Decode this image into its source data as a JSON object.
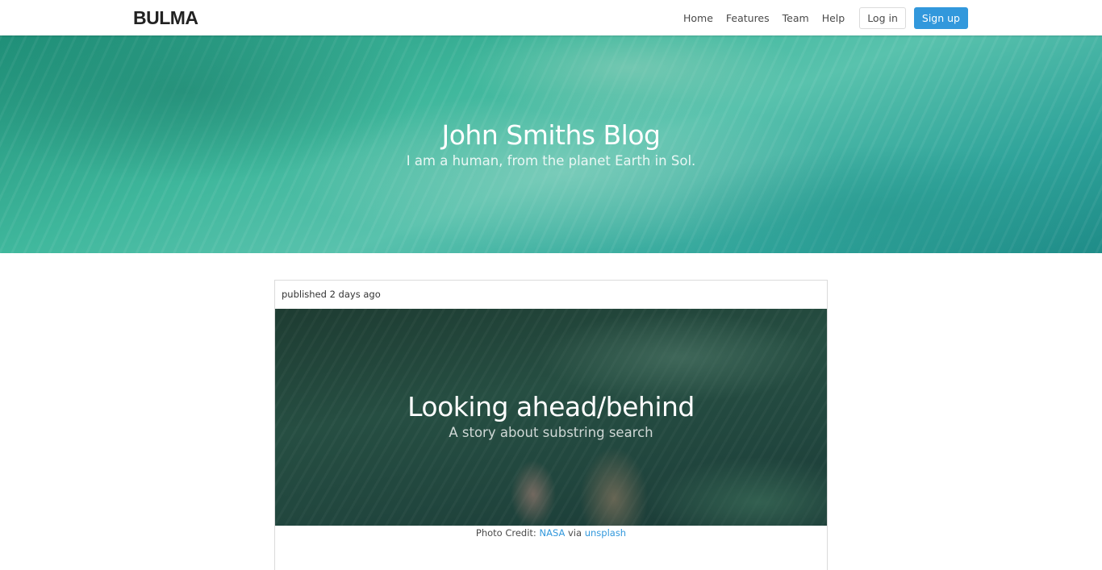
{
  "navbar": {
    "brand": "BULMA",
    "links": [
      "Home",
      "Features",
      "Team",
      "Help"
    ],
    "login_label": "Log in",
    "signup_label": "Sign up"
  },
  "hero": {
    "title": "John Smiths Blog",
    "subtitle": "I am a human, from the planet Earth in Sol."
  },
  "post": {
    "meta": "published 2 days ago",
    "title": "Looking ahead/behind",
    "subtitle": "A story about substring search",
    "credit_prefix": "Photo Credit:",
    "credit_source": "NASA",
    "credit_via": "via",
    "credit_site": "unsplash"
  },
  "colors": {
    "accent": "#3298dc",
    "text": "#4a4a4a"
  }
}
